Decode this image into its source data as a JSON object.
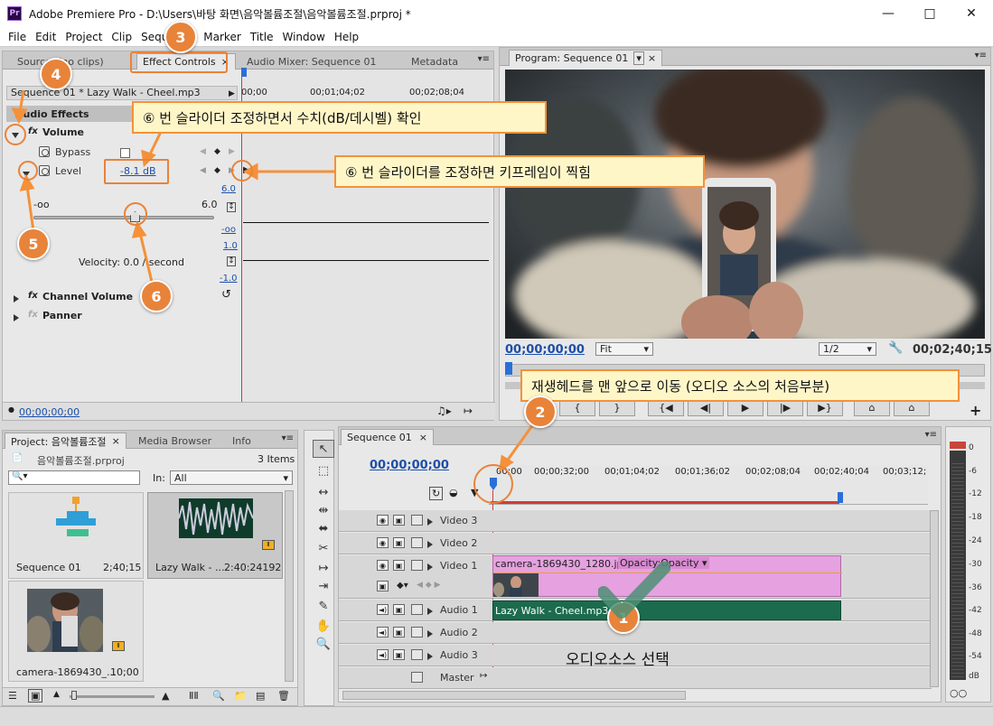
{
  "window": {
    "app_icon": "Pr",
    "title": "Adobe Premiere Pro - D:\\Users\\바탕 화면\\음악볼륨조절\\음악볼륨조절.prproj *"
  },
  "menu": [
    "File",
    "Edit",
    "Project",
    "Clip",
    "Sequence",
    "Marker",
    "Title",
    "Window",
    "Help"
  ],
  "effect_panel": {
    "tabs": [
      "Source: (no clips)",
      "Effect Controls",
      "Audio Mixer: Sequence 01",
      "Metadata"
    ],
    "clip_name": "Sequence 01 * Lazy Walk - Cheel.mp3",
    "ruler": [
      "00;00",
      "00;01;04;02",
      "00;02;08;04"
    ],
    "audio_effects": "Audio Effects",
    "volume": "Volume",
    "bypass": "Bypass",
    "level": "Level",
    "level_value": "-8.1 dB",
    "slider_min": "-oo",
    "slider_max": "6.0",
    "graph_top": "6.0",
    "graph_bottom": "-oo",
    "vel_top": "1.0",
    "vel_bottom": "-1.0",
    "velocity": "Velocity: 0.0 / second",
    "channel_volume": "Channel Volume",
    "panner": "Panner",
    "timecode": "00;00;00;00"
  },
  "program_panel": {
    "tab": "Program: Sequence 01",
    "timecode": "00;00;00;00",
    "fit": "Fit",
    "resolution": "1/2",
    "duration": "00;02;40;15"
  },
  "project_panel": {
    "tabs": [
      "Project: 음악볼륨조절",
      "Media Browser",
      "Info"
    ],
    "file": "음악볼륨조절.prproj",
    "count": "3 Items",
    "in_label": "In:",
    "in_value": "All",
    "items": [
      {
        "name": "Sequence 01",
        "duration": "2;40;15"
      },
      {
        "name": "Lazy Walk - ...",
        "duration": "2:40:24192"
      },
      {
        "name": "camera-1869430_...",
        "duration": "10;00"
      }
    ]
  },
  "timeline": {
    "tab": "Sequence 01",
    "timecode": "00;00;00;00",
    "ruler": [
      "00;00",
      "00;00;32;00",
      "00;01;04;02",
      "00;01;36;02",
      "00;02;08;04",
      "00;02;40;04",
      "00;03;12;"
    ],
    "tracks": [
      "Video 3",
      "Video 2",
      "Video 1",
      "Audio 1",
      "Audio 2",
      "Audio 3",
      "Master"
    ],
    "video_clip": "camera-1869430_1280.jpg",
    "opacity_label": "Opacity:Opacity",
    "audio_clip": "Lazy Walk - Cheel.mp3"
  },
  "meter_labels": [
    "0",
    "-6",
    "-12",
    "-18",
    "-24",
    "-30",
    "-36",
    "-42",
    "-48",
    "-54",
    "dB"
  ],
  "annotations": {
    "callout_slider": "⑥ 번 슬라이더 조정하면서 수치(dB/데시벨) 확인",
    "callout_keyframe": "⑥ 번 슬라이더를 조정하면 키프레임이 찍힘",
    "callout_playhead": "재생헤드를 맨 앞으로 이동 (오디오 소스의 처음부분)",
    "select_audio": "오디오소스 선택",
    "badges": [
      "1",
      "2",
      "3",
      "4",
      "5",
      "6"
    ]
  },
  "colors": {
    "accent_orange": "#e8833a",
    "video_clip": "#e6a1e0",
    "audio_clip": "#1c6b4e",
    "timecode_blue": "#1d4fa8",
    "playhead": "#d23a3a"
  },
  "icons": [
    "minimize-icon",
    "maximize-icon",
    "close-icon",
    "stopwatch-icon",
    "fx-icon",
    "reset-icon",
    "wrench-icon",
    "eye-icon",
    "speaker-icon",
    "checkmark-icon"
  ]
}
